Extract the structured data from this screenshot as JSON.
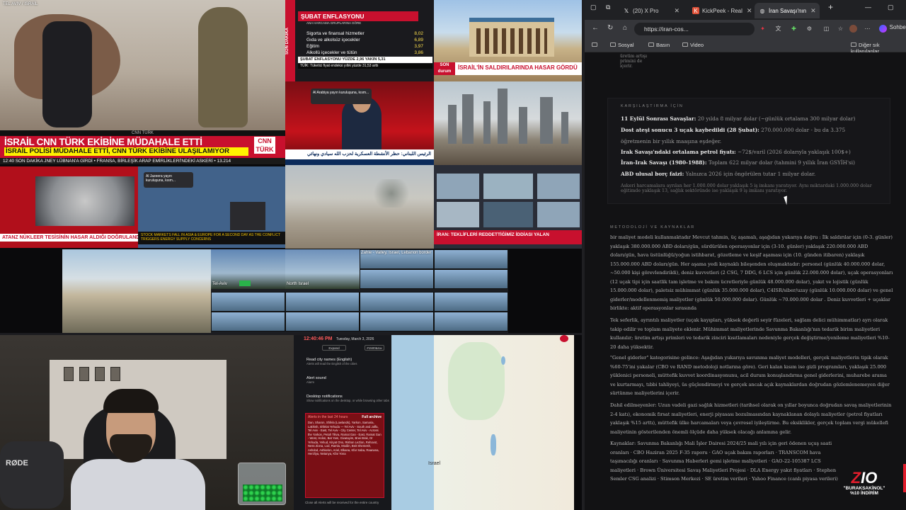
{
  "stream": {
    "top_left_tag": "TEL AVIV / İSRAİL",
    "cnn": {
      "strip": "CNN TÜRK",
      "headline": "İSRAİL CNN TÜRK EKİBİNE MÜDAHALE ETTİ",
      "subline": "İSRAİL POLİSİ MÜDAHALE ETTİ, CNN TÜRK EKİBİNE ULAŞILAMIYOR",
      "logo": "CNN TÜRK",
      "ticker": "12:40  SON DAKİKA  JNEY LÜBNAN'A GİRDİ  •  FRANSA, BİRLEŞİK ARAP EMİRLİKLERİ'NDEKİ ASKERİ  •  13.214"
    },
    "ntv": {
      "side": "SON DAKİKA",
      "headline": "ŞUBAT ENFLASYONU",
      "sub": "ANA HARCAMA GRUPLARINA GÖRE",
      "rows": [
        {
          "label": "Sigorta ve finansal hizmetler",
          "value": "8,02"
        },
        {
          "label": "Gıda ve alkolsüz içecekler",
          "value": "6,89"
        },
        {
          "label": "Eğitim",
          "value": "3,97"
        },
        {
          "label": "Alkollü içecekler ve tütün",
          "value": "3,86"
        }
      ],
      "footer": "ŞUBAT ENFLASYONU YÜZDE 2,96 YAKIN  5,31",
      "footer2": "TÜİK: Tüketici fiyat endeksi yıllık yüzde 31,53 arttı"
    },
    "palace": {
      "badge": "SON durum",
      "caption": "İSRAİL'İN SALDIRILARINDA HASAR GÖRDÜ"
    },
    "anchor": {
      "popup": "Al Arabiya yayın kuruluşuna, kısm...",
      "arabic": "الرئيس اللبناني: حظر الأنشطة العسكرية لحزب الله سيادي ونهائي"
    },
    "grid": {
      "strip": "ATANZ NÜKLEER TESİSİNİN HASAR ALDIĞI DOĞRULANDI",
      "popup": "Al Jazeera yayın kuruluşuna, kısm...",
      "ticker": "STOCK MARKETS FALL IN ASIA & EUROPE FOR A SECOND DAY AS THE CONFLICT TRIGGERS ENERGY SUPPLY CONCERNS"
    },
    "trt": {
      "caption": "İRAN: TEKLİFLERİ REDDETTİĞİMİZ İDDİASI YALAN",
      "badge": "SON DAKİKA"
    },
    "cams": {
      "label_a": "Tel-Aviv",
      "label_b": "North Israel",
      "label_c": "Zahle - Valley, Israel, Lebanon border"
    },
    "webcam": {
      "mic_brand": "RØDE"
    },
    "alerts": {
      "time": "12:40:46 PM",
      "date": "Tuesday, March 3, 2026",
      "pill_a": "Expand",
      "pill_b": "אמ&#1500",
      "sec1": "Read city names (English)",
      "sec1_sub": "Alerts will read the English of the cities",
      "sec2": "Alert sound",
      "sec2_sub": "Alarm",
      "sec3": "Desktop notifications",
      "sec3_sub": "Show notifications on the desktop, or while browsing other tabs",
      "list_title": "Alerts in the last 24 hours",
      "list_link": "Full archive",
      "list_text": "Dan, Sharon, Shfela (Lowlands), Yarkon, Samaria, Lakhish, Shfelat Yehuda — Tel Aviv - South and Jaffa, Tel Aviv - East, Tel Aviv - City Center, Tel Aviv - Across the Yarkon, Petah Tikva, Ramat Gan - East, Ramat Gan - West, Holon, Bat Yam, Givatayim, Bnei Brak, Or Yehuda, Yehud, Kiryat Ono, Rishon LeZion, Rehovot, Ness Ziona, Lod, Ramla, Modiin, Beit Shemesh, Ashdod, Ashkelon, Ariel, Elkana, Kfar Saba, Raanana, Herzliya, Netanya, Kfar Yona",
      "bottom": "Close all   Alerts will be received for the entire country"
    },
    "map": {
      "label": "Israel"
    }
  },
  "browser": {
    "tabs": [
      {
        "label": "(20) X Pro",
        "icon": "x-icon"
      },
      {
        "label": "KickPeek - Real",
        "icon": "kickpeek-icon"
      },
      {
        "label": "İran Savaşı'nın",
        "icon": "globe-icon"
      }
    ],
    "url": "https://iran-cos...",
    "sohbet": "Sohbet",
    "bookmarks": [
      "Sosyal",
      "Basın",
      "Video"
    ],
    "other_bookmarks": "Diğer sık kullanılanlar"
  },
  "page": {
    "fragment": [
      "üretim artışı",
      "primini de",
      "içerir."
    ],
    "compare": {
      "heading": "KARŞILAŞTIRMA İÇİN",
      "items": [
        {
          "bold": "11 Eylül Sonrası Savaşlar:",
          "text": " 20 yılda 8 milyar dolar (~günlük ortalama 300 milyar dolar)"
        },
        {
          "bold": "Dost ateşi sonucu 3 uçak kaybedildi (28 Şubat):",
          "text": " 270.000.000 dolar - bu da 3.375"
        },
        {
          "bold": "",
          "text": "öğretmenin bir yıllık maaşına eşdeğer."
        },
        {
          "bold": "Irak Savaşı'ndaki ortalama petrol fiyatı:",
          "text": " ~72$/varil (2026 dolarıyla yaklaşık 100$+)"
        },
        {
          "bold": "İran-Irak Savaşı (1980-1988):",
          "text": " Toplam 622 milyar dolar (tahmini 9 yıllık İran GSYİH'si)"
        },
        {
          "bold": "ABD ulusal borç faizi:",
          "text": " Yalnızca 2026 için öngörülen tutar 1 milyar dolar."
        }
      ],
      "note": "Askeri harcamalara ayrılan her 1.000.000 dolar yaklaşık 5 iş imkanı yaratıyor. Aynı miktardaki 1.000.000 dolar eğitimde yaklaşık 13, sağlık sektöründe ise yaklaşık 9 iş imkanı yaratıyor."
    },
    "method_heading": "METODOLOJİ VE KAYNAKLAR",
    "paragraphs": [
      "bir maliyet modeli kullanmaktadır Mevcut tahmin, üç aşamalı, aşağıdan yukarıya doğru : İlk saldırılar için (0-3. günler) yaklaşık 380.000.000 ABD doları/gün, sürdürülen operasyonlar için (3-10. günler) yaklaşık 220.000.000 ABD doları/gün, hava üstünlüğü/yoğun istihbarat, gözetleme ve keşif aşaması için (10. günden itibaren) yaklaşık 155.000.000 ABD doları/gün. Her aşama yedi kaynaklı bileşenden oluşmaktadır: personel (günlük 40.000.000 dolar, ~50.000 kişi görevlendirildi), deniz kuvvetleri (2 CSG, 7 DDG, 6 LCS için günlük 22.000.000 dolar), uçak operasyonları (12 uçak tipi için saatlik tam işletme ve bakım ücretleriyle günlük 48.000.000 dolar), yakıt ve lojistik (günlük 15.000.000 dolar), paletsiz mühimmat (günlük 35.000.000 dolar), C4ISR/siber/uzay (günlük 10.000.000 dolar) ve genel giderler/modellenmemiş maliyetler (günlük 50.000.000 dolar). Günlük ~70.000.000 dolar . Deniz kuvvetleri + uçaklar birlikte: aktif operasyonlar sırasında",
      "Tek seferlik, ayrıntılı maliyetler (uçak kayıpları, yüksek değerli seyir füzeleri, sağlam delici mühimmatlar) ayrı olarak takip edilir ve toplam maliyete eklenir. Mühimmat maliyetlerinde Savunma Bakanlığı'nın tedarik birim maliyetleri kullanılır; üretim artışı primleri ve tedarik zinciri kısıtlamaları nedeniyle gerçek değiştirme/yenileme maliyetleri %10-20 daha yüksektir.",
      "\"Genel giderler\" kategorisine gelince: Aşağıdan yukarıya savunma maliyet modelleri, gerçek maliyetlerin tipik olarak %60-75'ini yakalar (CBO ve RAND metodoloji notlarına göre). Geri kalan kısım ise gizli programları, yaklaşık 25.000 yüklenici personeli, müttefik kuvvet koordinasyonunu, acil durum konuşlandırma genel giderlerini, muharebe arama ve kurtarmayı, tıbbi tahliyeyi, üs güçlendirmeyi ve gerçek ancak açık kaynaklardan doğrudan gözlemlenemeyen diğer sürtünme maliyetlerini içerir.",
      "Dahil edilmeyenler: Uzun vadeli gazi sağlık hizmetleri (tarihsel olarak on yıllar boyunca doğrudan savaş maliyetlerinin 2-4 katı), ekonomik fırsat maliyetleri, enerji piyasası bozulmasından kaynaklanan dolaylı maliyetler (petrol fiyatları yaklaşık %15 arttı), müttefik ülke harcamaları veya çevresel iyileştirme. Bu eksiklikler, gerçek toplam vergi mükellefi maliyetinin gösterilenden önemli ölçüde daha yüksek olacağı anlamına gelir.",
      "Kaynaklar: Savunma Bakanlığı Mali İşler Dairesi 2024/25 mali yılı için geri ödenen uçuş saati oranları · CBO Haziran 2025 F-35 raporu · GAO uçak bakım raporları · TRANSCOM hava taşımacılığı oranları · Savunma Haberleri gemi işletme maliyetleri · GAO-22-105387 LCS maliyetleri · Brown Üniversitesi Savaş Maliyetleri Projesi · DLA Energy yakıt fiyatları · Stephen Semler CSG analizi · Stimson Merkezi · SE üretim verileri · Yahoo Finance (canlı piyasa verileri)"
    ],
    "promo": {
      "logo_a": "Z",
      "logo_b": "IO",
      "code": "\"BURAKSAKİNOL\"",
      "discount": "%10 İNDİRİM"
    }
  }
}
